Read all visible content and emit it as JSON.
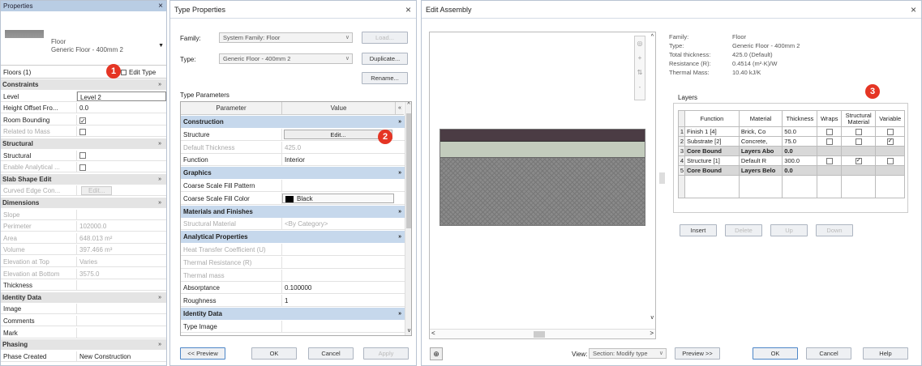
{
  "properties": {
    "title": "Properties",
    "type_line1": "Floor",
    "type_line2": "Generic Floor - 400mm 2",
    "instance": "Floors (1)",
    "edit_type": "Edit Type",
    "rows": [
      {
        "g": "Constraints"
      },
      {
        "l": "Level",
        "v": "Level 2",
        "box": true
      },
      {
        "l": "Height Offset Fro...",
        "v": "0.0"
      },
      {
        "l": "Room Bounding",
        "chk": "on"
      },
      {
        "l": "Related to Mass",
        "chk": "off",
        "grey": true
      },
      {
        "g": "Structural"
      },
      {
        "l": "Structural",
        "chk": "off"
      },
      {
        "l": "Enable Analytical ...",
        "chk": "off",
        "grey": true
      },
      {
        "g": "Slab Shape Edit"
      },
      {
        "l": "Curved Edge Con...",
        "v": "Edit...",
        "grey": true,
        "btn": true
      },
      {
        "g": "Dimensions"
      },
      {
        "l": "Slope",
        "v": "",
        "grey": true
      },
      {
        "l": "Perimeter",
        "v": "102000.0",
        "grey": true
      },
      {
        "l": "Area",
        "v": "648.013 m²",
        "grey": true
      },
      {
        "l": "Volume",
        "v": "397.466 m³",
        "grey": true
      },
      {
        "l": "Elevation at Top",
        "v": "Varies",
        "grey": true
      },
      {
        "l": "Elevation at Bottom",
        "v": "3575.0",
        "grey": true
      },
      {
        "l": "Thickness",
        "v": ""
      },
      {
        "g": "Identity Data"
      },
      {
        "l": "Image",
        "v": ""
      },
      {
        "l": "Comments",
        "v": ""
      },
      {
        "l": "Mark",
        "v": ""
      },
      {
        "g": "Phasing"
      },
      {
        "l": "Phase Created",
        "v": "New Construction"
      }
    ]
  },
  "type_props": {
    "title": "Type Properties",
    "family_label": "Family:",
    "family": "System Family: Floor",
    "type_label": "Type:",
    "type": "Generic Floor - 400mm 2",
    "load": "Load...",
    "duplicate": "Duplicate...",
    "rename": "Rename...",
    "section": "Type Parameters",
    "col_param": "Parameter",
    "col_value": "Value",
    "rows": [
      {
        "g": "Construction"
      },
      {
        "l": "Structure",
        "v": "Edit...",
        "btn": true
      },
      {
        "l": "Default Thickness",
        "v": "425.0",
        "grey": true
      },
      {
        "l": "Function",
        "v": "Interior"
      },
      {
        "g": "Graphics"
      },
      {
        "l": "Coarse Scale Fill Pattern",
        "v": ""
      },
      {
        "l": "Coarse Scale Fill Color",
        "v": "Black",
        "swatch": true
      },
      {
        "g": "Materials and Finishes"
      },
      {
        "l": "Structural Material",
        "v": "<By Category>",
        "grey": true
      },
      {
        "g": "Analytical Properties"
      },
      {
        "l": "Heat Transfer Coefficient (U)",
        "v": "",
        "grey": true
      },
      {
        "l": "Thermal Resistance (R)",
        "v": "",
        "grey": true
      },
      {
        "l": "Thermal mass",
        "v": "",
        "grey": true
      },
      {
        "l": "Absorptance",
        "v": "0.100000"
      },
      {
        "l": "Roughness",
        "v": "1"
      },
      {
        "g": "Identity Data"
      },
      {
        "l": "Type Image",
        "v": ""
      }
    ],
    "preview": "<< Preview",
    "ok": "OK",
    "cancel": "Cancel",
    "apply": "Apply"
  },
  "assembly": {
    "title": "Edit Assembly",
    "info_labels": [
      "Family:",
      "Type:",
      "Total thickness:",
      "Resistance (R):",
      "Thermal Mass:"
    ],
    "info_values": [
      "Floor",
      "Generic Floor - 400mm 2",
      "425.0 (Default)",
      "0.4514 (m²·K)/W",
      "10.40 kJ/K"
    ],
    "layers_label": "Layers",
    "headers": [
      "",
      "Function",
      "Material",
      "Thickness",
      "Wraps",
      "Structural Material",
      "Variable"
    ],
    "layers": [
      {
        "n": "1",
        "f": "Finish 1 [4]",
        "m": "Brick, Co",
        "t": "50.0",
        "w": "off",
        "s": "off",
        "v": "off"
      },
      {
        "n": "2",
        "f": "Substrate [2]",
        "m": "Concrete,",
        "t": "75.0",
        "w": "off",
        "s": "off",
        "v": "on"
      },
      {
        "n": "3",
        "f": "Core Bound",
        "m": "Layers Abo",
        "t": "0.0",
        "core": true
      },
      {
        "n": "4",
        "f": "Structure [1]",
        "m": "Default R",
        "t": "300.0",
        "w": "off",
        "s": "on",
        "v": "off"
      },
      {
        "n": "5",
        "f": "Core Bound",
        "m": "Layers Belo",
        "t": "0.0",
        "core": true
      }
    ],
    "insert": "Insert",
    "delete": "Delete",
    "up": "Up",
    "down": "Down",
    "view_label": "View:",
    "view": "Section: Modify type",
    "preview": "Preview >>",
    "ok": "OK",
    "cancel": "Cancel",
    "help": "Help"
  },
  "badges": [
    "1",
    "2",
    "3"
  ]
}
